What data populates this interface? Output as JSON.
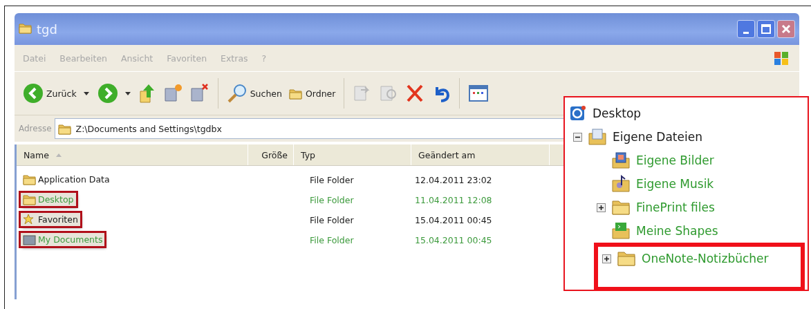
{
  "window": {
    "title": "tgd"
  },
  "menu": [
    "Datei",
    "Bearbeiten",
    "Ansicht",
    "Favoriten",
    "Extras",
    "?"
  ],
  "toolbar": [
    {
      "kind": "back",
      "label": "Zurück"
    },
    {
      "kind": "forward"
    },
    {
      "kind": "up"
    },
    {
      "kind": "copy-to"
    },
    {
      "kind": "delete-folder"
    },
    {
      "kind": "search",
      "label": "Suchen"
    },
    {
      "kind": "folders",
      "label": "Ordner"
    },
    {
      "kind": "move"
    },
    {
      "kind": "copy"
    },
    {
      "kind": "delete"
    },
    {
      "kind": "undo"
    },
    {
      "kind": "views"
    }
  ],
  "address": {
    "label": "Adresse",
    "value": "Z:\\Documents and Settings\\tgdbx"
  },
  "table": {
    "columns": [
      "Name",
      "Größe",
      "Typ",
      "Geändert am"
    ],
    "rows": [
      {
        "kind": "folder",
        "name": "Application Data",
        "type": "File Folder",
        "modified": "12.04.2011 23:02",
        "color": "#1a1a1a",
        "highlighted": false
      },
      {
        "kind": "folder",
        "name": "Desktop",
        "type": "File Folder",
        "modified": "11.04.2011 12:08",
        "color": "#3c9a3c",
        "highlighted": true
      },
      {
        "kind": "favorites",
        "name": "Favoriten",
        "type": "File Folder",
        "modified": "15.04.2011 00:45",
        "color": "#1a1a1a",
        "highlighted": true
      },
      {
        "kind": "documents",
        "name": "My Documents",
        "type": "File Folder",
        "modified": "15.04.2011 00:45",
        "color": "#3c9a3c",
        "highlighted": true
      }
    ]
  },
  "tree": {
    "label": "Desktop",
    "kind": "desktop",
    "color": "#1a1a1a",
    "children": [
      {
        "label": "Eigene Dateien",
        "kind": "documents",
        "color": "#1a1a1a",
        "expanded": true,
        "highlighted": false,
        "children": [
          {
            "label": "Eigene Bilder",
            "kind": "pictures",
            "color": "#2e9a2e",
            "highlighted": false
          },
          {
            "label": "Eigene Musik",
            "kind": "music",
            "color": "#2e9a2e",
            "highlighted": false
          },
          {
            "label": "FinePrint files",
            "kind": "folder",
            "color": "#2e9a2e",
            "expanded": false,
            "highlighted": false
          },
          {
            "label": "Meine Shapes",
            "kind": "shapes",
            "color": "#2e9a2e",
            "highlighted": false
          },
          {
            "label": "OneNote-Notizbücher",
            "kind": "folder",
            "color": "#2e9a2e",
            "expanded": false,
            "highlighted": true
          }
        ]
      }
    ]
  }
}
